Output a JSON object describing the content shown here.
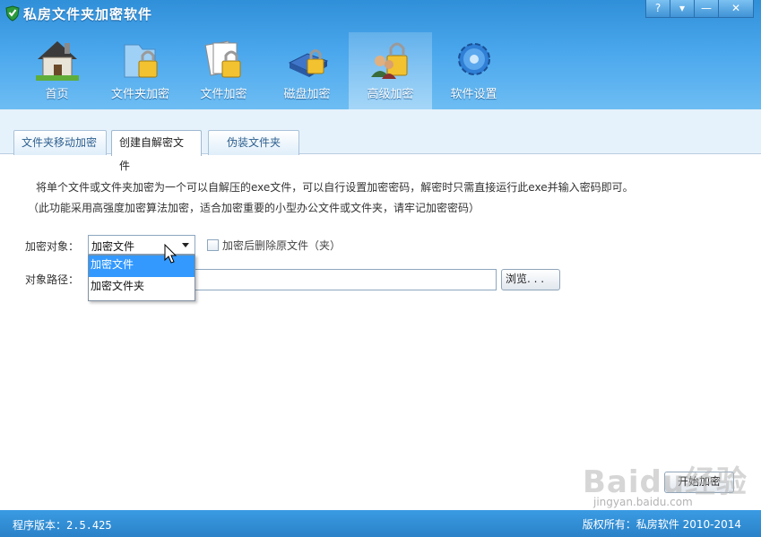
{
  "window": {
    "title": "私房文件夹加密软件",
    "controls": {
      "help": "?",
      "menu": "▾",
      "minimize": "—",
      "close": "✕"
    }
  },
  "nav": {
    "items": [
      {
        "label": "首页",
        "icon": "house-icon"
      },
      {
        "label": "文件夹加密",
        "icon": "folder-lock-icon"
      },
      {
        "label": "文件加密",
        "icon": "file-lock-icon"
      },
      {
        "label": "磁盘加密",
        "icon": "disk-lock-icon"
      },
      {
        "label": "高级加密",
        "icon": "users-lock-icon"
      },
      {
        "label": "软件设置",
        "icon": "gear-icon"
      }
    ],
    "active": "高级加密"
  },
  "tabs": {
    "items": [
      {
        "label": "文件夹移动加密"
      },
      {
        "label": "创建自解密文件"
      },
      {
        "label": "伪装文件夹"
      }
    ],
    "active": "创建自解密文件"
  },
  "content": {
    "description": "将单个文件或文件夹加密为一个可以自解压的exe文件，可以自行设置加密密码，解密时只需直接运行此exe并输入密码即可。",
    "note": "（此功能采用高强度加密算法加密，适合加密重要的小型办公文件或文件夹，请牢记加密密码）",
    "target_label": "加密对象：",
    "target_select": {
      "value": "加密文件",
      "options": [
        "加密文件",
        "加密文件夹"
      ],
      "highlighted": "加密文件"
    },
    "delete_original_label": "加密后删除原文件（夹）",
    "path_label": "对象路径：",
    "path_value": "",
    "browse_label": "浏览. . .",
    "start_label": "开始加密"
  },
  "watermark": {
    "brand": "Baidu经验",
    "url": "jingyan.baidu.com"
  },
  "statusbar": {
    "version": "程序版本：2.5.425",
    "copyright": "版权所有：私房软件 2010-2014"
  }
}
